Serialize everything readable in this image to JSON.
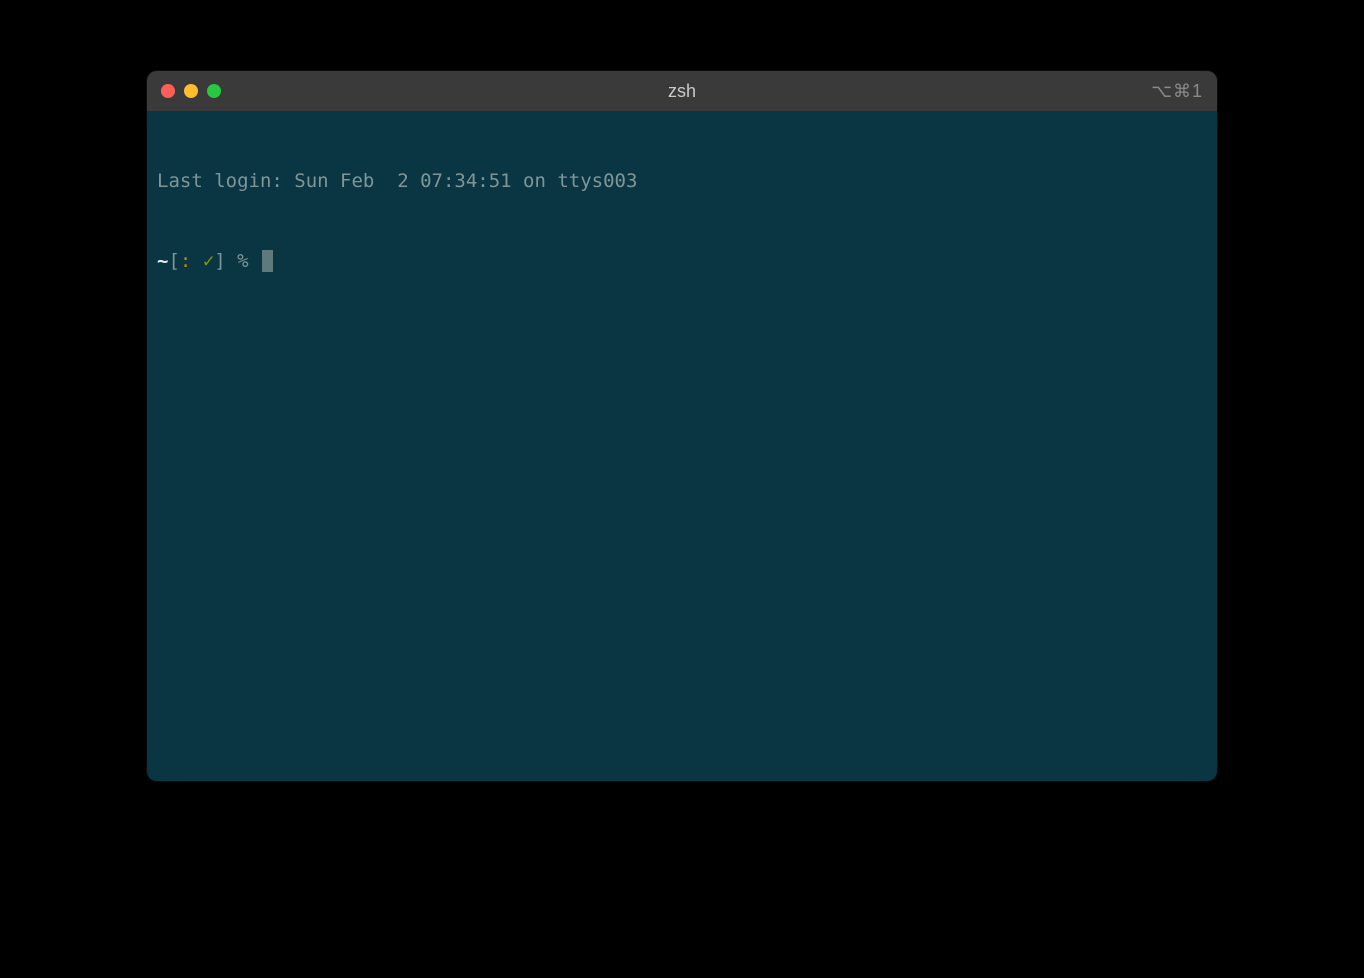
{
  "window": {
    "title": "zsh",
    "tab_hint": "⌥⌘1"
  },
  "terminal": {
    "last_login": "Last login: Sun Feb  2 07:34:51 on ttys003",
    "prompt": {
      "tilde": "~",
      "open_bracket": "[",
      "colon": ":",
      "check": "✓",
      "close_bracket": "]",
      "symbol": "%"
    }
  }
}
